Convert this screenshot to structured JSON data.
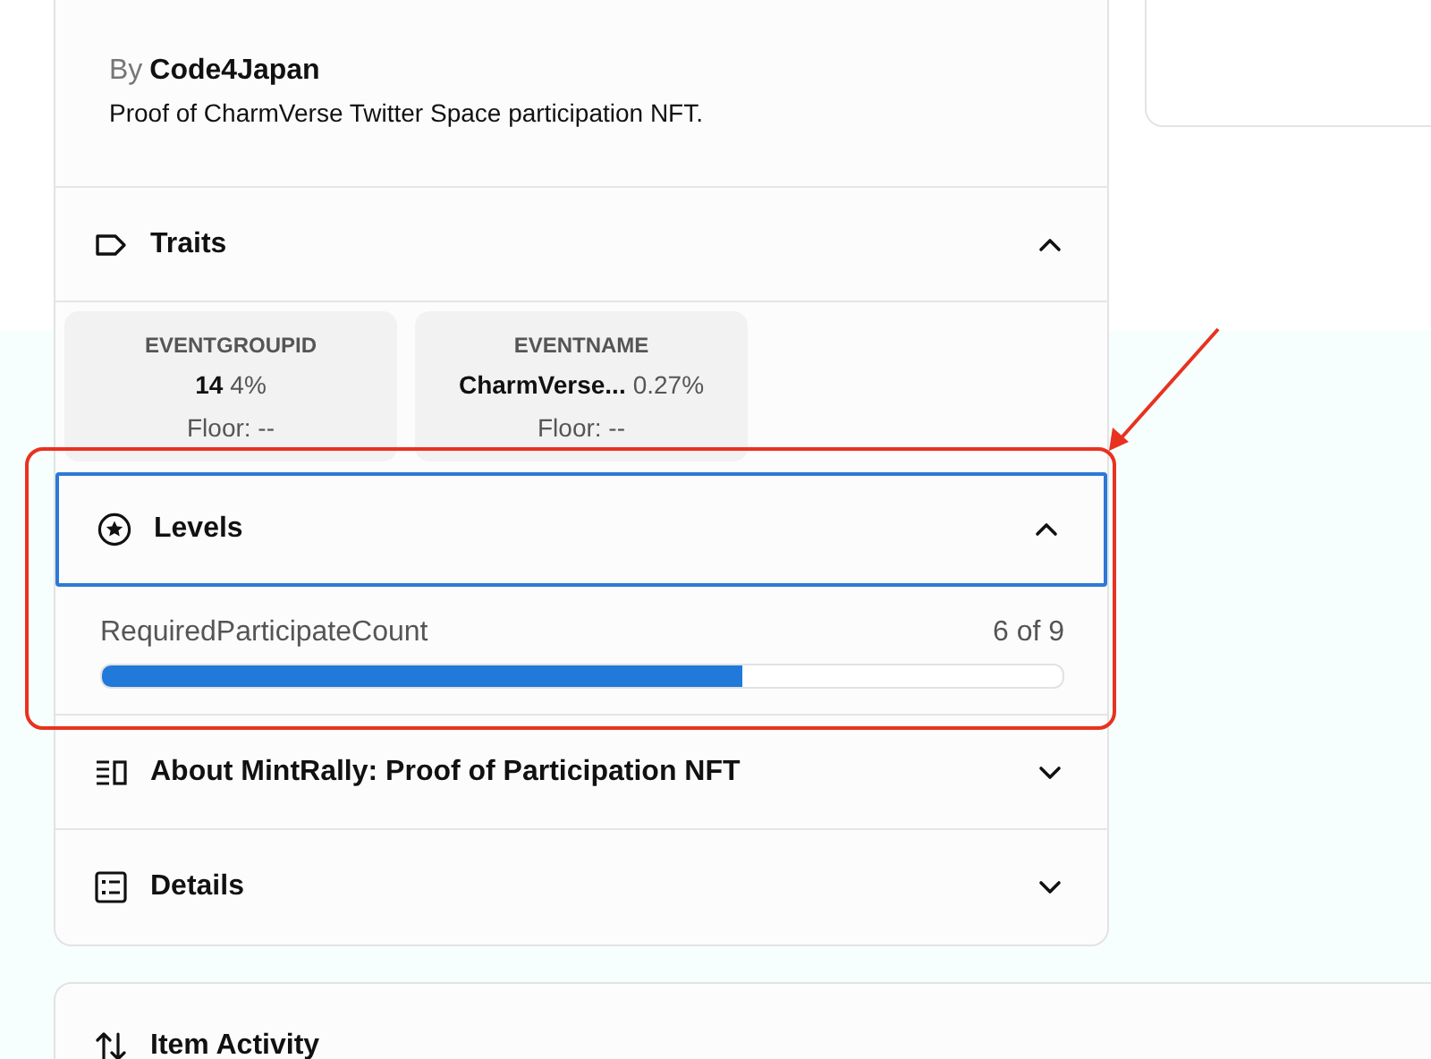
{
  "creator": {
    "prefix": "By",
    "name": "Code4Japan"
  },
  "description": "Proof of CharmVerse Twitter Space participation NFT.",
  "traits": {
    "title": "Traits",
    "expanded": true,
    "items": [
      {
        "type": "EVENTGROUPID",
        "value": "14",
        "share": "4%",
        "floor": "Floor: --"
      },
      {
        "type": "EVENTNAME",
        "value": "CharmVerse...",
        "share": "0.27%",
        "floor": "Floor: --"
      }
    ]
  },
  "levels": {
    "title": "Levels",
    "expanded": true,
    "focused": true,
    "items": [
      {
        "name": "RequiredParticipateCount",
        "reading": "6 of 9",
        "level": 0.667
      }
    ]
  },
  "sections": [
    {
      "kind": "about",
      "title": "About MintRally: Proof of Participation NFT",
      "expanded": false
    },
    {
      "kind": "details",
      "title": "Details",
      "expanded": false
    }
  ],
  "activity": {
    "title": "Item Activity"
  }
}
